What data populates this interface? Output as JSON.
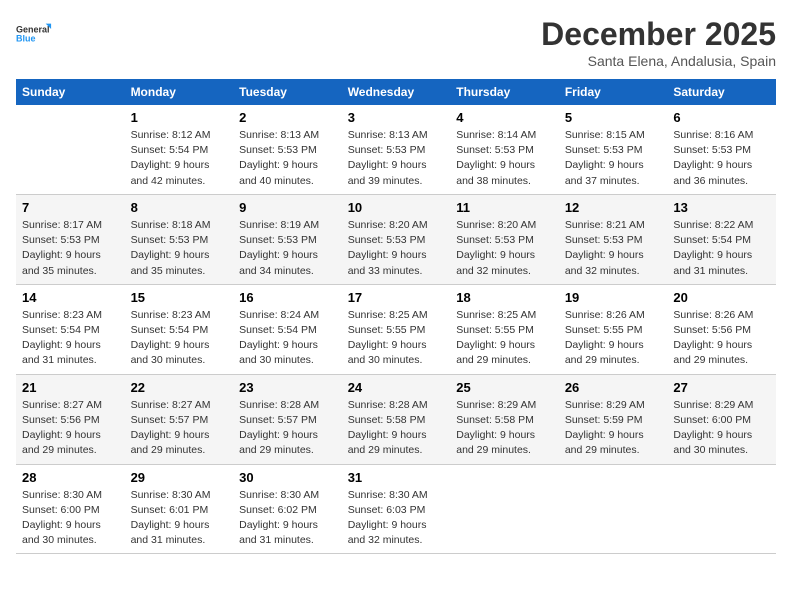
{
  "logo": {
    "line1": "General",
    "line2": "Blue"
  },
  "title": "December 2025",
  "subtitle": "Santa Elena, Andalusia, Spain",
  "days_header": [
    "Sunday",
    "Monday",
    "Tuesday",
    "Wednesday",
    "Thursday",
    "Friday",
    "Saturday"
  ],
  "weeks": [
    [
      {
        "day": "",
        "info": ""
      },
      {
        "day": "1",
        "info": "Sunrise: 8:12 AM\nSunset: 5:54 PM\nDaylight: 9 hours\nand 42 minutes."
      },
      {
        "day": "2",
        "info": "Sunrise: 8:13 AM\nSunset: 5:53 PM\nDaylight: 9 hours\nand 40 minutes."
      },
      {
        "day": "3",
        "info": "Sunrise: 8:13 AM\nSunset: 5:53 PM\nDaylight: 9 hours\nand 39 minutes."
      },
      {
        "day": "4",
        "info": "Sunrise: 8:14 AM\nSunset: 5:53 PM\nDaylight: 9 hours\nand 38 minutes."
      },
      {
        "day": "5",
        "info": "Sunrise: 8:15 AM\nSunset: 5:53 PM\nDaylight: 9 hours\nand 37 minutes."
      },
      {
        "day": "6",
        "info": "Sunrise: 8:16 AM\nSunset: 5:53 PM\nDaylight: 9 hours\nand 36 minutes."
      }
    ],
    [
      {
        "day": "7",
        "info": "Sunrise: 8:17 AM\nSunset: 5:53 PM\nDaylight: 9 hours\nand 35 minutes."
      },
      {
        "day": "8",
        "info": "Sunrise: 8:18 AM\nSunset: 5:53 PM\nDaylight: 9 hours\nand 35 minutes."
      },
      {
        "day": "9",
        "info": "Sunrise: 8:19 AM\nSunset: 5:53 PM\nDaylight: 9 hours\nand 34 minutes."
      },
      {
        "day": "10",
        "info": "Sunrise: 8:20 AM\nSunset: 5:53 PM\nDaylight: 9 hours\nand 33 minutes."
      },
      {
        "day": "11",
        "info": "Sunrise: 8:20 AM\nSunset: 5:53 PM\nDaylight: 9 hours\nand 32 minutes."
      },
      {
        "day": "12",
        "info": "Sunrise: 8:21 AM\nSunset: 5:53 PM\nDaylight: 9 hours\nand 32 minutes."
      },
      {
        "day": "13",
        "info": "Sunrise: 8:22 AM\nSunset: 5:54 PM\nDaylight: 9 hours\nand 31 minutes."
      }
    ],
    [
      {
        "day": "14",
        "info": "Sunrise: 8:23 AM\nSunset: 5:54 PM\nDaylight: 9 hours\nand 31 minutes."
      },
      {
        "day": "15",
        "info": "Sunrise: 8:23 AM\nSunset: 5:54 PM\nDaylight: 9 hours\nand 30 minutes."
      },
      {
        "day": "16",
        "info": "Sunrise: 8:24 AM\nSunset: 5:54 PM\nDaylight: 9 hours\nand 30 minutes."
      },
      {
        "day": "17",
        "info": "Sunrise: 8:25 AM\nSunset: 5:55 PM\nDaylight: 9 hours\nand 30 minutes."
      },
      {
        "day": "18",
        "info": "Sunrise: 8:25 AM\nSunset: 5:55 PM\nDaylight: 9 hours\nand 29 minutes."
      },
      {
        "day": "19",
        "info": "Sunrise: 8:26 AM\nSunset: 5:55 PM\nDaylight: 9 hours\nand 29 minutes."
      },
      {
        "day": "20",
        "info": "Sunrise: 8:26 AM\nSunset: 5:56 PM\nDaylight: 9 hours\nand 29 minutes."
      }
    ],
    [
      {
        "day": "21",
        "info": "Sunrise: 8:27 AM\nSunset: 5:56 PM\nDaylight: 9 hours\nand 29 minutes."
      },
      {
        "day": "22",
        "info": "Sunrise: 8:27 AM\nSunset: 5:57 PM\nDaylight: 9 hours\nand 29 minutes."
      },
      {
        "day": "23",
        "info": "Sunrise: 8:28 AM\nSunset: 5:57 PM\nDaylight: 9 hours\nand 29 minutes."
      },
      {
        "day": "24",
        "info": "Sunrise: 8:28 AM\nSunset: 5:58 PM\nDaylight: 9 hours\nand 29 minutes."
      },
      {
        "day": "25",
        "info": "Sunrise: 8:29 AM\nSunset: 5:58 PM\nDaylight: 9 hours\nand 29 minutes."
      },
      {
        "day": "26",
        "info": "Sunrise: 8:29 AM\nSunset: 5:59 PM\nDaylight: 9 hours\nand 29 minutes."
      },
      {
        "day": "27",
        "info": "Sunrise: 8:29 AM\nSunset: 6:00 PM\nDaylight: 9 hours\nand 30 minutes."
      }
    ],
    [
      {
        "day": "28",
        "info": "Sunrise: 8:30 AM\nSunset: 6:00 PM\nDaylight: 9 hours\nand 30 minutes."
      },
      {
        "day": "29",
        "info": "Sunrise: 8:30 AM\nSunset: 6:01 PM\nDaylight: 9 hours\nand 31 minutes."
      },
      {
        "day": "30",
        "info": "Sunrise: 8:30 AM\nSunset: 6:02 PM\nDaylight: 9 hours\nand 31 minutes."
      },
      {
        "day": "31",
        "info": "Sunrise: 8:30 AM\nSunset: 6:03 PM\nDaylight: 9 hours\nand 32 minutes."
      },
      {
        "day": "",
        "info": ""
      },
      {
        "day": "",
        "info": ""
      },
      {
        "day": "",
        "info": ""
      }
    ]
  ]
}
